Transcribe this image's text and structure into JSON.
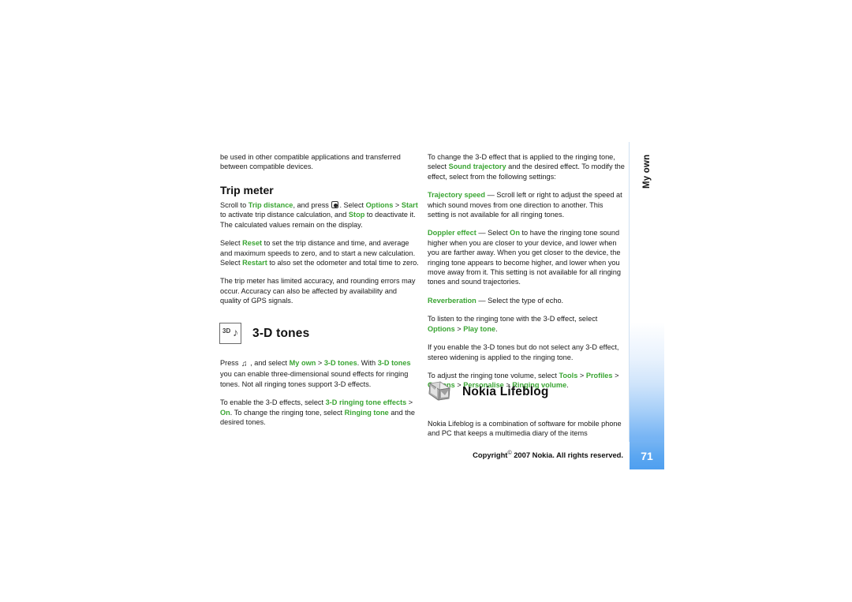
{
  "document": {
    "page_number": "71",
    "chapter_tab": "My own",
    "footer": {
      "prefix": "Copyright",
      "symbol": "©",
      "suffix": "2007 Nokia. All rights reserved."
    },
    "colors": {
      "highlight_green": "#3aa533",
      "body_text": "#1a1a1a",
      "tab_blue": "#5aa6f1",
      "page_badge_blue": "#4f9fef"
    }
  },
  "left_column": {
    "intro_paragraph": "be used in other compatible applications and transferred between compatible devices.",
    "heading_trip_meter": "Trip meter",
    "paragraphs": [
      {
        "id": "trip-p1",
        "runs": [
          {
            "t": "Scroll to ",
            "s": "n"
          },
          {
            "t": "Trip distance",
            "s": "h"
          },
          {
            "t": ", and press ",
            "s": "n"
          },
          {
            "t": "KEY_OK",
            "s": "key"
          },
          {
            "t": ". Select ",
            "s": "n"
          },
          {
            "t": "Options",
            "s": "h"
          },
          {
            "t": " > ",
            "s": "n"
          },
          {
            "t": "Start",
            "s": "h"
          },
          {
            "t": " to activate trip distance calculation, and ",
            "s": "n"
          },
          {
            "t": "Stop",
            "s": "h"
          },
          {
            "t": " to deactivate it. The calculated values remain on the display.",
            "s": "n"
          }
        ]
      },
      {
        "id": "trip-p2",
        "runs": [
          {
            "t": "Select ",
            "s": "n"
          },
          {
            "t": "Reset",
            "s": "h"
          },
          {
            "t": " to set the trip distance and time, and average and maximum speeds to zero, and to start a new calculation. Select ",
            "s": "n"
          },
          {
            "t": "Restart",
            "s": "h"
          },
          {
            "t": " to also set the odometer and total time to zero.",
            "s": "n"
          }
        ]
      },
      {
        "id": "trip-p3",
        "runs": [
          {
            "t": "The trip meter has limited accuracy, and rounding errors may occur. Accuracy can also be affected by availability and quality of GPS signals.",
            "s": "n"
          }
        ]
      }
    ],
    "chapter_3d": {
      "icon": "3d-tones-icon",
      "icon_label": "3D",
      "title": "3-D tones",
      "paragraphs": [
        {
          "id": "3d-p1",
          "runs": [
            {
              "t": "Press ",
              "s": "n"
            },
            {
              "t": "KEY_MENU",
              "s": "menu"
            },
            {
              "t": " , and select ",
              "s": "n"
            },
            {
              "t": "My own",
              "s": "h"
            },
            {
              "t": " > ",
              "s": "n"
            },
            {
              "t": "3-D tones",
              "s": "h"
            },
            {
              "t": ". With ",
              "s": "n"
            },
            {
              "t": "3-D tones",
              "s": "h"
            },
            {
              "t": " you can enable three-dimensional sound effects for ringing tones. Not all ringing tones support 3-D effects.",
              "s": "n"
            }
          ]
        },
        {
          "id": "3d-p2",
          "runs": [
            {
              "t": "To enable the 3-D effects, select ",
              "s": "n"
            },
            {
              "t": "3-D ringing tone effects",
              "s": "h"
            },
            {
              "t": " > ",
              "s": "n"
            },
            {
              "t": "On",
              "s": "h"
            },
            {
              "t": ". To change the ringing tone, select ",
              "s": "n"
            },
            {
              "t": "Ringing tone",
              "s": "h"
            },
            {
              "t": " and the desired tones.",
              "s": "n"
            }
          ]
        }
      ]
    }
  },
  "right_column": {
    "paragraphs": [
      {
        "id": "r-p1",
        "runs": [
          {
            "t": "To change the 3-D effect that is applied to the ringing tone, select ",
            "s": "n"
          },
          {
            "t": "Sound trajectory",
            "s": "h"
          },
          {
            "t": " and the desired effect. To modify the effect, select from the following settings:",
            "s": "n"
          }
        ]
      },
      {
        "id": "r-p2",
        "runs": [
          {
            "t": "Trajectory speed",
            "s": "h"
          },
          {
            "t": " — Scroll left or right to adjust the speed at which sound moves from one direction to another. This setting is not available for all ringing tones.",
            "s": "n"
          }
        ]
      },
      {
        "id": "r-p3",
        "runs": [
          {
            "t": "Doppler effect",
            "s": "h"
          },
          {
            "t": " — Select ",
            "s": "n"
          },
          {
            "t": "On",
            "s": "h"
          },
          {
            "t": " to have the ringing tone sound higher when you are closer to your device, and lower when you are farther away. When you get closer to the device, the ringing tone appears to become higher, and lower when you move away from it. This setting is not available for all ringing tones and sound trajectories.",
            "s": "n"
          }
        ]
      },
      {
        "id": "r-p4",
        "runs": [
          {
            "t": "Reverberation",
            "s": "h"
          },
          {
            "t": " — Select the type of echo.",
            "s": "n"
          }
        ]
      },
      {
        "id": "r-p5",
        "runs": [
          {
            "t": "To listen to the ringing tone with the 3-D effect, select ",
            "s": "n"
          },
          {
            "t": "Options",
            "s": "h"
          },
          {
            "t": " > ",
            "s": "n"
          },
          {
            "t": "Play tone",
            "s": "h"
          },
          {
            "t": ".",
            "s": "n"
          }
        ]
      },
      {
        "id": "r-p6",
        "runs": [
          {
            "t": "If you enable the 3-D tones but do not select any 3-D effect, stereo widening is applied to the ringing tone.",
            "s": "n"
          }
        ]
      },
      {
        "id": "r-p7",
        "runs": [
          {
            "t": "To adjust the ringing tone volume, select ",
            "s": "n"
          },
          {
            "t": "Tools",
            "s": "h"
          },
          {
            "t": " > ",
            "s": "n"
          },
          {
            "t": "Profiles",
            "s": "h"
          },
          {
            "t": " > ",
            "s": "n"
          },
          {
            "t": "Options",
            "s": "h"
          },
          {
            "t": " > ",
            "s": "n"
          },
          {
            "t": "Personalise",
            "s": "h"
          },
          {
            "t": " > ",
            "s": "n"
          },
          {
            "t": "Ringing volume",
            "s": "h"
          },
          {
            "t": ".",
            "s": "n"
          }
        ]
      }
    ],
    "chapter_lifeblog": {
      "icon": "nokia-lifeblog-icon",
      "title": "Nokia Lifeblog",
      "paragraphs": [
        {
          "id": "lb-p1",
          "runs": [
            {
              "t": "Nokia Lifeblog is a combination of software for mobile phone and PC that keeps a multimedia diary of the items",
              "s": "n"
            }
          ]
        }
      ]
    }
  }
}
